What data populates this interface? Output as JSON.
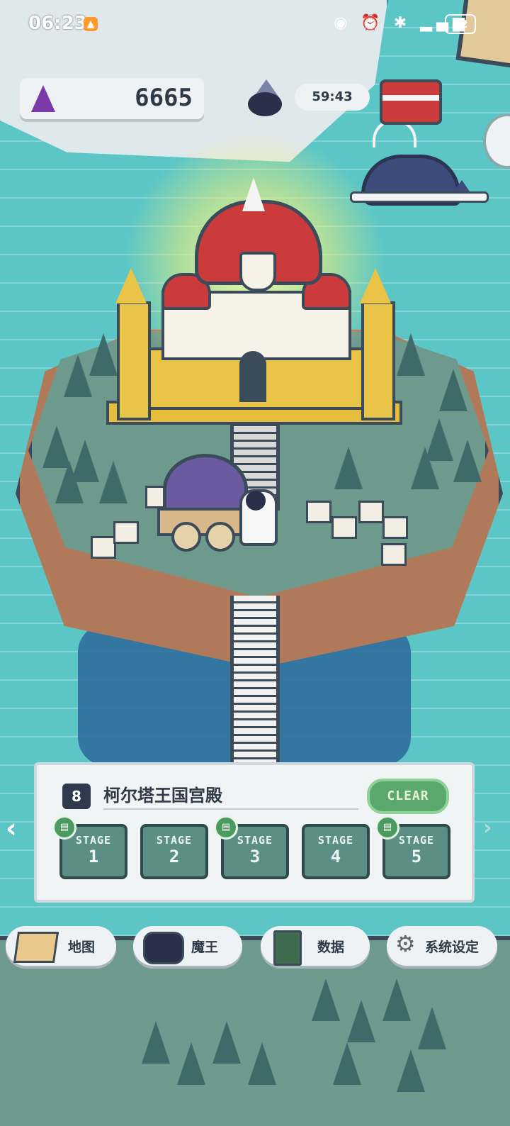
{
  "status_bar": {
    "time": "06:23",
    "icons": [
      "eye-icon",
      "alarm-icon",
      "bluetooth-icon",
      "signal-4g-icon",
      "wifi-icon"
    ],
    "battery": "82"
  },
  "hud": {
    "gems": "6665",
    "timer": "59:43"
  },
  "stage_panel": {
    "number": "8",
    "title": "柯尔塔王国宫殿",
    "clear_label": "CLEAR",
    "stages": [
      {
        "label": "STAGE",
        "num": "1",
        "has_book": true
      },
      {
        "label": "STAGE",
        "num": "2",
        "has_book": false
      },
      {
        "label": "STAGE",
        "num": "3",
        "has_book": true
      },
      {
        "label": "STAGE",
        "num": "4",
        "has_book": false
      },
      {
        "label": "STAGE",
        "num": "5",
        "has_book": true
      }
    ]
  },
  "menu": {
    "map": "地图",
    "demon_king": "魔王",
    "data": "数据",
    "settings": "系统设定"
  },
  "colors": {
    "sea": "#5cc6c6",
    "clear_green": "#5aa86b",
    "stage_teal": "#5b8f85",
    "gem_purple": "#7b3aa8",
    "dome_red": "#cc3b3b",
    "castle_gold": "#e9c447"
  }
}
